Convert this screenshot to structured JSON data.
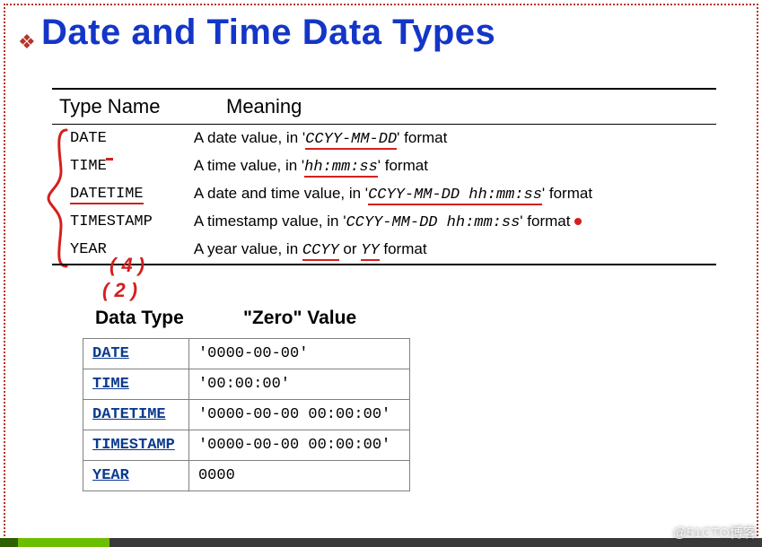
{
  "title": "Date and Time Data Types",
  "defs": {
    "headers": {
      "type": "Type Name",
      "meaning": "Meaning"
    },
    "rows": [
      {
        "type": "DATE",
        "meaning_pre": "A date value, in '",
        "fmt": "CCYY-MM-DD",
        "meaning_post": "' format"
      },
      {
        "type": "TIME",
        "meaning_pre": "A time value, in '",
        "fmt": "hh:mm:ss",
        "meaning_post": "' format"
      },
      {
        "type": "DATETIME",
        "meaning_pre": "A date and time value, in '",
        "fmt": "CCYY-MM-DD hh:mm:ss",
        "meaning_post": "' format"
      },
      {
        "type": "TIMESTAMP",
        "meaning_pre": "A timestamp value, in '",
        "fmt": "CCYY-MM-DD hh:mm:ss",
        "meaning_post": "' format"
      },
      {
        "type": "YEAR",
        "meaning_pre": "A year value, in ",
        "fmt": "CCYY",
        "meaning_mid": " or ",
        "fmt2": "YY",
        "meaning_post": " format"
      }
    ]
  },
  "annotations": {
    "year4": "( 4 )",
    "year2": "( 2 )"
  },
  "zero": {
    "headers": {
      "type": "Data Type",
      "val": "\"Zero\" Value"
    },
    "rows": [
      {
        "type": "DATE",
        "val": "'0000-00-00'"
      },
      {
        "type": "TIME",
        "val": "'00:00:00'"
      },
      {
        "type": "DATETIME",
        "val": "'0000-00-00 00:00:00'"
      },
      {
        "type": "TIMESTAMP",
        "val": "'0000-00-00 00:00:00'"
      },
      {
        "type": "YEAR",
        "val": "0000"
      }
    ]
  },
  "watermark": "@51CTO博客"
}
